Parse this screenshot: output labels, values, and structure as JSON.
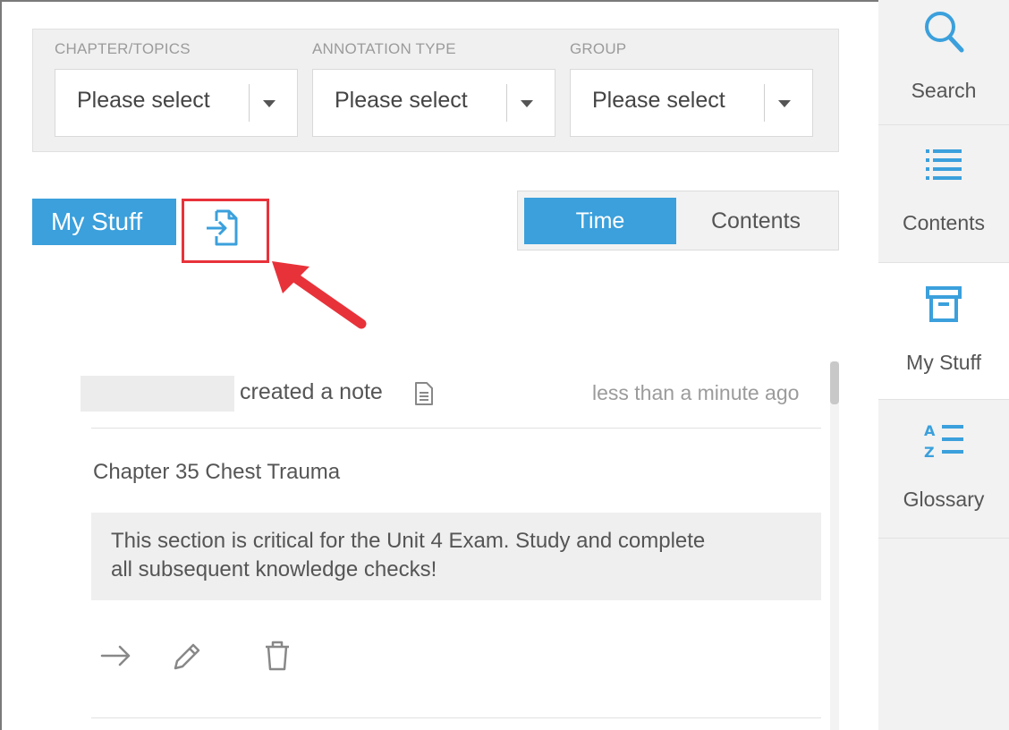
{
  "filters": [
    {
      "label": "CHAPTER/TOPICS",
      "value": "Please select"
    },
    {
      "label": "ANNOTATION TYPE",
      "value": "Please select"
    },
    {
      "label": "GROUP",
      "value": "Please select"
    }
  ],
  "header": {
    "my_stuff_label": "My Stuff",
    "export_icon": "export-icon"
  },
  "sort_toggle": {
    "time_label": "Time",
    "contents_label": "Contents",
    "selected": "Time"
  },
  "note": {
    "action": "created a note",
    "time": "less than a minute ago",
    "chapter": "Chapter 35 Chest Trauma",
    "body_line1": "This section is critical for the Unit 4 Exam. Study and complete",
    "body_line2": "all subsequent knowledge checks!"
  },
  "sidebar": {
    "items": [
      {
        "label": "Search",
        "icon": "search-icon"
      },
      {
        "label": "Contents",
        "icon": "list-icon"
      },
      {
        "label": "My Stuff",
        "icon": "archive-box-icon",
        "active": true
      },
      {
        "label": "Glossary",
        "icon": "sort-az-icon"
      }
    ]
  },
  "colors": {
    "accent": "#3ba0dc",
    "highlight": "#e8323a"
  }
}
